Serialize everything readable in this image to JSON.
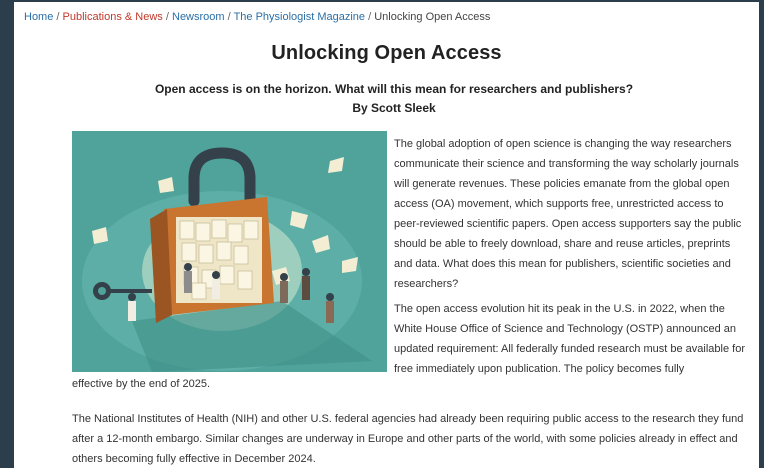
{
  "breadcrumb": {
    "home": "Home",
    "sep": "/",
    "publications": "Publications & News",
    "newsroom": "Newsroom",
    "magazine": "The Physiologist Magazine",
    "current": "Unlocking Open Access"
  },
  "article": {
    "title": "Unlocking Open Access",
    "subtitle": "Open access is on the horizon. What will this mean for researchers and publishers?",
    "byline": "By Scott Sleek",
    "paragraph1": "The global adoption of open science is changing the way researchers communicate their science and transforming the way scholarly journals will generate revenues. These policies emanate from the global open access (OA) movement, which supports free, unrestricted access to peer-reviewed scientific papers. Open access supporters say the public should be able to freely download, share and reuse articles, preprints and data. What does this mean for publishers, scientific societies and researchers?",
    "paragraph2": "The open access evolution hit its peak in the U.S. in 2022, when the White House Office of Science and Technology (OSTP) announced an updated requirement: All federally funded research must be available for free immediately upon publication. The policy becomes fully",
    "paragraph2_tail": "effective by the end of 2025.",
    "paragraph3": "The National Institutes of Health (NIH) and other U.S. federal agencies had already been requiring public access to the research they fund after a 12-month embargo. Similar changes are underway in Europe and other parts of the world, with some policies already in effect and others becoming fully effective in December 2024."
  },
  "figure": {
    "icon": "padlock-illustration-icon",
    "colors": {
      "background": "#4fa39b",
      "lock": "#c9742f",
      "shackle": "#34404a"
    }
  }
}
